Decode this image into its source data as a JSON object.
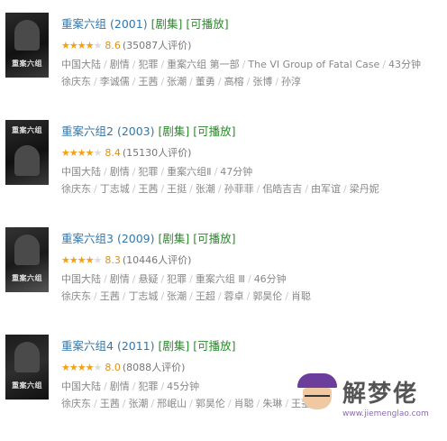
{
  "items": [
    {
      "title": "重案六组",
      "year": "(2001)",
      "tags": [
        "[剧集]",
        "[可播放]"
      ],
      "poster_text": "重案六组",
      "stars": "★★★★",
      "stars_empty": "★",
      "score": "8.6",
      "votes": "(35087人评价)",
      "meta1": [
        "中国大陆",
        "剧情",
        "犯罪",
        "重案六组 第一部",
        "The VI Group of Fatal Case",
        "43分钟"
      ],
      "meta2": [
        "徐庆东",
        "李诚儒",
        "王茜",
        "张潮",
        "董勇",
        "高榕",
        "张博",
        "孙淳"
      ]
    },
    {
      "title": "重案六组2",
      "year": "(2003)",
      "tags": [
        "[剧集]",
        "[可播放]"
      ],
      "poster_text": "重案六组",
      "stars": "★★★★",
      "stars_empty": "★",
      "score": "8.4",
      "votes": "(15130人评价)",
      "meta1": [
        "中国大陆",
        "剧情",
        "犯罪",
        "重案六组Ⅱ",
        "47分钟"
      ],
      "meta2": [
        "徐庆东",
        "丁志城",
        "王茜",
        "王挺",
        "张潮",
        "孙菲菲",
        "佀皓吉吉",
        "由军谊",
        "梁丹妮"
      ]
    },
    {
      "title": "重案六组3",
      "year": "(2009)",
      "tags": [
        "[剧集]",
        "[可播放]"
      ],
      "poster_text": "重案六组",
      "stars": "★★★★",
      "stars_empty": "★",
      "score": "8.3",
      "votes": "(10446人评价)",
      "meta1": [
        "中国大陆",
        "剧情",
        "悬疑",
        "犯罪",
        "重案六组 Ⅲ",
        "46分钟"
      ],
      "meta2": [
        "徐庆东",
        "王茜",
        "丁志城",
        "张潮",
        "王超",
        "蓉卓",
        "郭昊伦",
        "肖聪"
      ]
    },
    {
      "title": "重案六组4",
      "year": "(2011)",
      "tags": [
        "[剧集]",
        "[可播放]"
      ],
      "poster_text": "重案六组",
      "stars": "★★★★",
      "stars_empty": "★",
      "score": "8.0",
      "votes": "(8088人评价)",
      "meta1": [
        "中国大陆",
        "剧情",
        "犯罪",
        "45分钟"
      ],
      "meta2": [
        "徐庆东",
        "王茜",
        "张潮",
        "邢岷山",
        "郭昊伦",
        "肖聪",
        "朱琳",
        "王茎"
      ]
    }
  ],
  "watermark": {
    "brand": "解梦佬",
    "url": "www.jiemenglao.com"
  }
}
